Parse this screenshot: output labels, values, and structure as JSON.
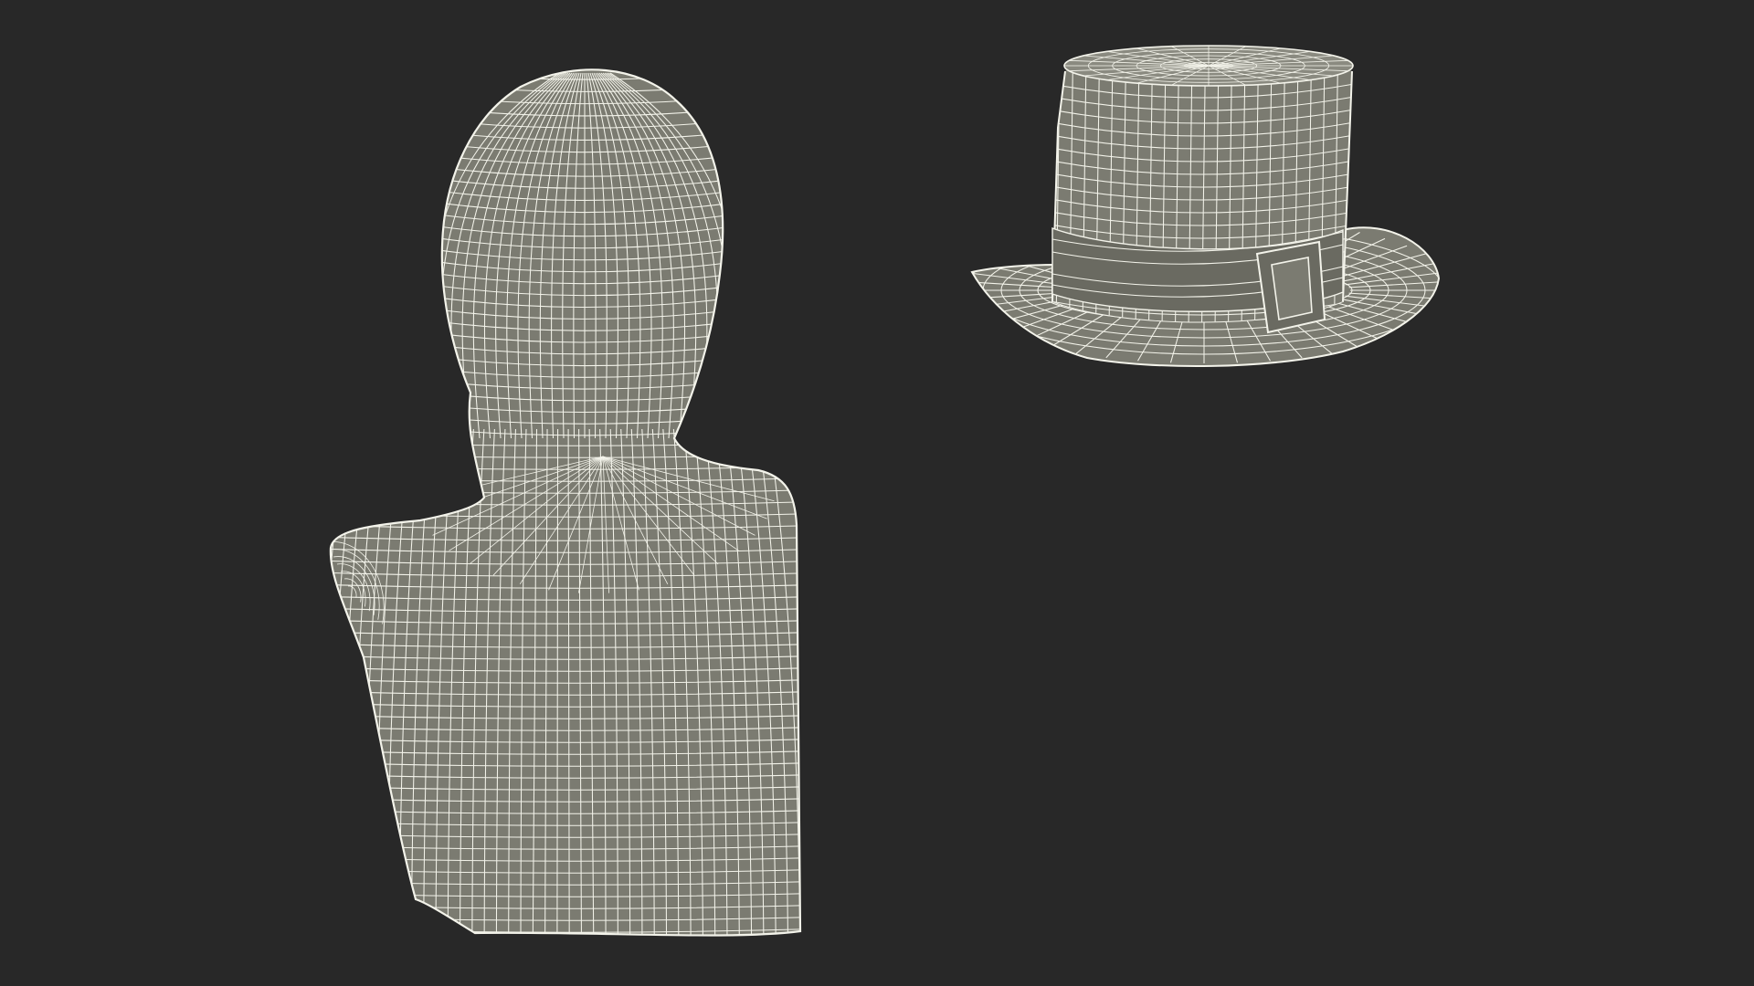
{
  "scene": {
    "background_color": "#282828",
    "mesh_fill_color": "#7b7b71",
    "mesh_shade_color": "#6a6a61",
    "mesh_highlight_color": "#8a8a80",
    "wire_color": "#f3f3ea",
    "objects": [
      {
        "name": "mannequin-bust"
      },
      {
        "name": "top-hat-with-buckle"
      }
    ]
  }
}
